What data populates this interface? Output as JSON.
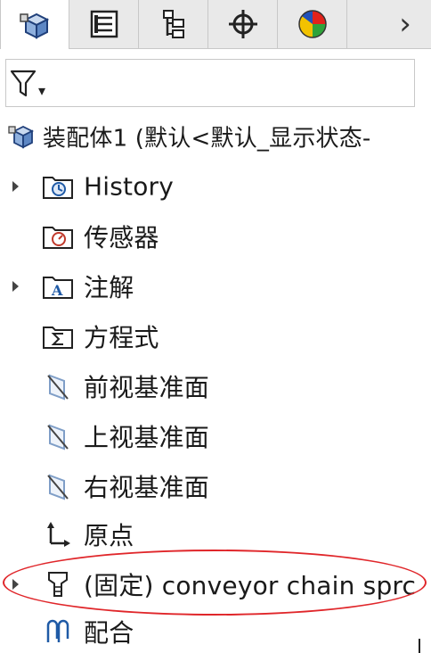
{
  "tabs": [
    {
      "name": "featuremanager",
      "icon": "assembly-cube-icon",
      "active": true
    },
    {
      "name": "propertymanager",
      "icon": "property-list-icon",
      "active": false
    },
    {
      "name": "configurationmanager",
      "icon": "configuration-tree-icon",
      "active": false
    },
    {
      "name": "dimxpertmanager",
      "icon": "crosshair-icon",
      "active": false
    },
    {
      "name": "displaymanager",
      "icon": "color-pie-icon",
      "active": false
    }
  ],
  "tab_next_glyph": "›",
  "filter": {
    "icon": "filter-funnel-icon",
    "dropdown_glyph": "▾"
  },
  "tree": {
    "root": {
      "label": "装配体1  (默认<默认_显示状态-",
      "icon": "assembly-icon"
    },
    "items": [
      {
        "label": "History",
        "icon": "history-folder-icon",
        "expandable": true
      },
      {
        "label": "传感器",
        "icon": "sensors-folder-icon",
        "expandable": false
      },
      {
        "label": "注解",
        "icon": "annotations-folder-icon",
        "expandable": true
      },
      {
        "label": "方程式",
        "icon": "equations-folder-icon",
        "expandable": false
      },
      {
        "label": "前视基准面",
        "icon": "plane-icon",
        "expandable": false
      },
      {
        "label": "上视基准面",
        "icon": "plane-icon",
        "expandable": false
      },
      {
        "label": "右视基准面",
        "icon": "plane-icon",
        "expandable": false
      },
      {
        "label": "原点",
        "icon": "origin-icon",
        "expandable": false
      },
      {
        "label": "(固定) conveyor chain sprc",
        "icon": "part-icon",
        "expandable": true
      },
      {
        "label": "配合",
        "icon": "mates-icon",
        "expandable": false
      }
    ]
  },
  "colors": {
    "highlight": "#e0262a",
    "accent": "#1f5aa6"
  }
}
